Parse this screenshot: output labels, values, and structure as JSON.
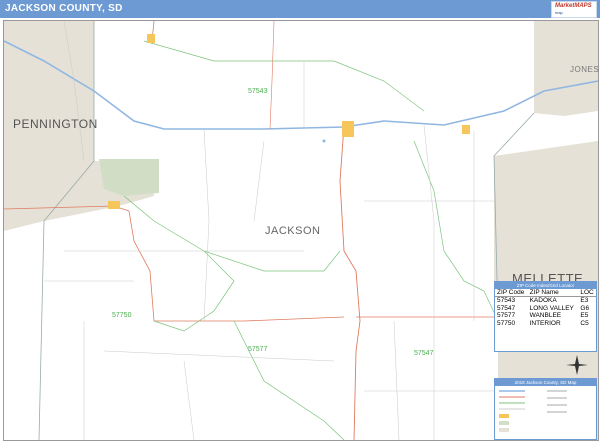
{
  "title": "JACKSON COUNTY, SD",
  "logo": {
    "line1": "MarketMAPS",
    "line2": "map"
  },
  "counties": {
    "pennington": "PENNINGTON",
    "jones": "JONES",
    "mellette": "MELLETTE",
    "jackson": "JACKSON"
  },
  "zip_labels": [
    "57543",
    "57750",
    "57577",
    "57547"
  ],
  "legend": {
    "header": "ZIP Code Index/Grid Locator",
    "columns": [
      "ZIP Code",
      "ZIP Name",
      "LOC"
    ],
    "rows": [
      {
        "zip": "57543",
        "name": "KADOKA",
        "loc": "E3"
      },
      {
        "zip": "57547",
        "name": "LONG VALLEY",
        "loc": "G6"
      },
      {
        "zip": "57577",
        "name": "WANBLEE",
        "loc": "E5"
      },
      {
        "zip": "57750",
        "name": "INTERIOR",
        "loc": "C5"
      }
    ]
  },
  "map_key": {
    "header": "2018 Jackson County, SD Map"
  },
  "colors": {
    "title_bar": "#6d9ad3",
    "county_bg": "#e5e1d6",
    "park_green": "#d2ddc6",
    "highway": "#8fb7e2",
    "road": "#e07a5f",
    "zip_boundary": "#7cc47c",
    "city": "#f6c65b"
  }
}
